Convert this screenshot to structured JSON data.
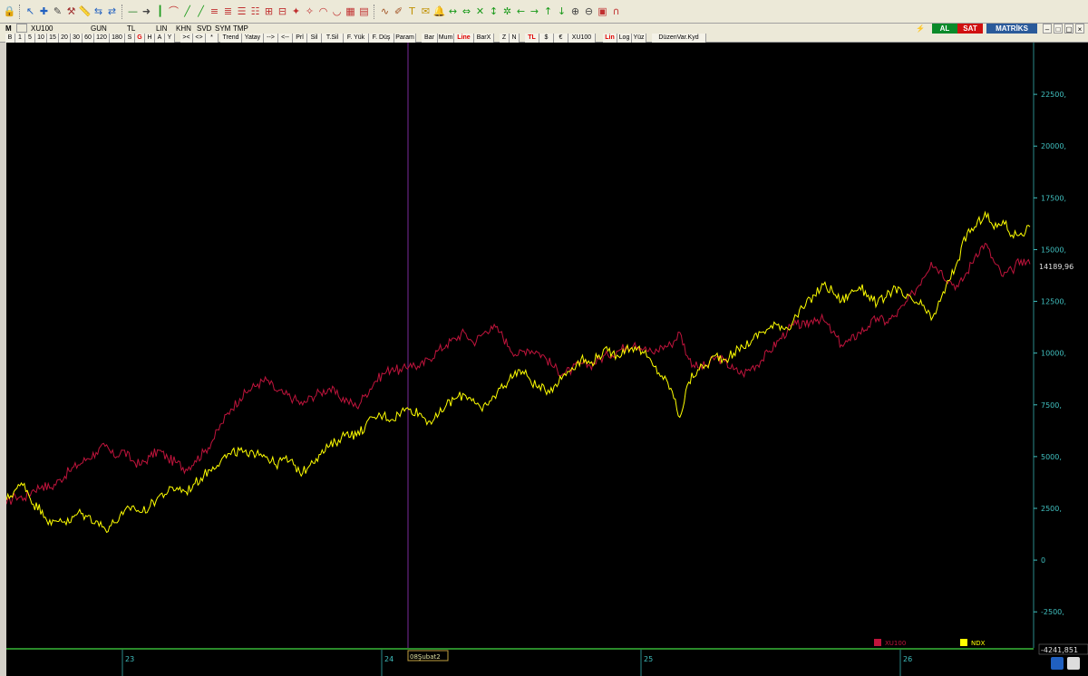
{
  "toolbar": {
    "icons": [
      "lock-icon",
      "cursor-icon",
      "crosshair-icon",
      "pencil-icon",
      "hammer-icon",
      "ruler-icon",
      "align-icon",
      "arrows-icon",
      "minus-icon",
      "vision-icon",
      "line-icon",
      "curve-icon",
      "channel-icon",
      "channel2-icon",
      "fib-icon",
      "fib2-icon",
      "fib3-icon",
      "fib4-icon",
      "gann-icon",
      "gann2-icon",
      "fan-icon",
      "fan2-icon",
      "arc-icon",
      "arc2-icon",
      "grid-icon",
      "grid2-icon",
      "wave-icon",
      "brush-icon",
      "text-icon",
      "note-icon",
      "bell-icon",
      "expand-icon",
      "compress-icon",
      "cross-icon",
      "updown-icon",
      "star-icon",
      "left-icon",
      "right-icon",
      "up-icon",
      "down-icon",
      "zoom-in-icon",
      "zoom-out-icon",
      "image-icon",
      "magnet-icon"
    ]
  },
  "row2": {
    "menu": "M",
    "symbol": "XU100",
    "period": "GUN",
    "currency": "TL",
    "scale": "LIN",
    "khn": "KHN",
    "svd": "SVD",
    "sym": "SYM",
    "tmp": "TMP",
    "al": "AL",
    "sat": "SAT",
    "brand": "MATRİKS"
  },
  "row3": {
    "periods": [
      "B",
      "1",
      "5",
      "10",
      "15",
      "20",
      "30",
      "60",
      "120",
      "180",
      "S",
      "G",
      "H",
      "A",
      "Y"
    ],
    "nav": [
      ">< ",
      "<>",
      "*"
    ],
    "tools": [
      "Trend",
      "Yatay",
      "-->",
      "<--",
      "Prl",
      "Sil",
      "T.Sil",
      "F. Yük",
      "F. Düş",
      "Param"
    ],
    "styles": [
      "Bar",
      "Mum",
      "Line",
      "BarX"
    ],
    "flags": [
      "Z",
      "N"
    ],
    "curr": [
      "TL",
      "$",
      "€",
      "XU100"
    ],
    "axis": [
      "Lin",
      "Log",
      "Yüz"
    ],
    "extra": "DüzenVar.Kyd"
  },
  "chart_data": {
    "type": "line",
    "x_ticks": [
      "23",
      "24",
      "25",
      "26"
    ],
    "y_ticks": [
      22500,
      20000,
      17500,
      15000,
      12500,
      10000,
      7500,
      5000,
      2500,
      0,
      -2500
    ],
    "y_tick_labels": [
      "22500,",
      "20000,",
      "17500,",
      "15000,",
      "12500,",
      "10000,",
      "7500,",
      "5000,",
      "2500,",
      "0",
      "-2500,"
    ],
    "ylim": [
      -4241.85,
      25000
    ],
    "last_value_label": "14189,96",
    "bottom_value_label": "-4241,851",
    "cursor_label": "08Şubat2",
    "series": [
      {
        "name": "XU100",
        "color": "#c0143c",
        "points": [
          [
            0,
            2700
          ],
          [
            2,
            3100
          ],
          [
            4,
            3000
          ],
          [
            6,
            3400
          ],
          [
            8,
            3600
          ],
          [
            10,
            3500
          ],
          [
            12,
            3900
          ],
          [
            14,
            4300
          ],
          [
            16,
            4600
          ],
          [
            18,
            4900
          ],
          [
            20,
            5200
          ],
          [
            22,
            5500
          ],
          [
            24,
            5000
          ],
          [
            26,
            5300
          ],
          [
            28,
            4800
          ],
          [
            30,
            4600
          ],
          [
            32,
            5000
          ],
          [
            34,
            5300
          ],
          [
            36,
            4900
          ],
          [
            38,
            4700
          ],
          [
            40,
            4400
          ],
          [
            42,
            4800
          ],
          [
            44,
            5200
          ],
          [
            46,
            5800
          ],
          [
            48,
            6600
          ],
          [
            50,
            7300
          ],
          [
            52,
            7800
          ],
          [
            54,
            8200
          ],
          [
            56,
            8500
          ],
          [
            58,
            8700
          ],
          [
            60,
            8200
          ],
          [
            62,
            8000
          ],
          [
            64,
            7800
          ],
          [
            66,
            7500
          ],
          [
            68,
            7900
          ],
          [
            70,
            8100
          ],
          [
            72,
            8300
          ],
          [
            74,
            7900
          ],
          [
            76,
            7700
          ],
          [
            78,
            7400
          ],
          [
            80,
            8000
          ],
          [
            82,
            8600
          ],
          [
            84,
            9000
          ],
          [
            86,
            9300
          ],
          [
            88,
            9100
          ],
          [
            90,
            9500
          ],
          [
            92,
            9300
          ],
          [
            94,
            9700
          ],
          [
            96,
            10100
          ],
          [
            98,
            10400
          ],
          [
            100,
            10700
          ],
          [
            102,
            11000
          ],
          [
            104,
            10500
          ],
          [
            106,
            10900
          ],
          [
            108,
            11300
          ],
          [
            110,
            11000
          ],
          [
            112,
            10300
          ],
          [
            114,
            9900
          ],
          [
            116,
            10200
          ],
          [
            118,
            10100
          ],
          [
            120,
            9800
          ],
          [
            122,
            9300
          ],
          [
            124,
            9000
          ],
          [
            126,
            9200
          ],
          [
            128,
            9500
          ],
          [
            130,
            9400
          ],
          [
            132,
            9700
          ],
          [
            134,
            9900
          ],
          [
            136,
            10100
          ],
          [
            138,
            10300
          ],
          [
            140,
            10500
          ],
          [
            142,
            10200
          ],
          [
            144,
            10000
          ],
          [
            146,
            10300
          ],
          [
            148,
            10400
          ],
          [
            150,
            11000
          ],
          [
            152,
            9700
          ],
          [
            154,
            9300
          ],
          [
            156,
            9400
          ],
          [
            158,
            9800
          ],
          [
            160,
            9600
          ],
          [
            162,
            9200
          ],
          [
            164,
            9000
          ],
          [
            166,
            9300
          ],
          [
            168,
            9600
          ],
          [
            170,
            10100
          ],
          [
            172,
            10600
          ],
          [
            174,
            11100
          ],
          [
            176,
            11400
          ],
          [
            178,
            11300
          ],
          [
            180,
            11700
          ],
          [
            182,
            11600
          ],
          [
            184,
            11000
          ],
          [
            186,
            10400
          ],
          [
            188,
            10600
          ],
          [
            190,
            11000
          ],
          [
            192,
            11300
          ],
          [
            194,
            11700
          ],
          [
            196,
            11500
          ],
          [
            198,
            11800
          ],
          [
            200,
            12300
          ],
          [
            202,
            12900
          ],
          [
            204,
            13600
          ],
          [
            206,
            14400
          ],
          [
            208,
            14000
          ],
          [
            210,
            13500
          ],
          [
            212,
            13200
          ],
          [
            214,
            13900
          ],
          [
            216,
            14800
          ],
          [
            218,
            15300
          ],
          [
            220,
            14400
          ],
          [
            222,
            13700
          ],
          [
            224,
            14000
          ],
          [
            226,
            14500
          ],
          [
            228,
            14300
          ]
        ]
      },
      {
        "name": "NDX",
        "color": "#ffff00",
        "points": [
          [
            0,
            2900
          ],
          [
            2,
            3400
          ],
          [
            4,
            3700
          ],
          [
            6,
            2700
          ],
          [
            8,
            2400
          ],
          [
            10,
            1700
          ],
          [
            12,
            2000
          ],
          [
            14,
            1800
          ],
          [
            16,
            2300
          ],
          [
            18,
            2100
          ],
          [
            20,
            1900
          ],
          [
            22,
            1500
          ],
          [
            24,
            1800
          ],
          [
            26,
            2200
          ],
          [
            28,
            2600
          ],
          [
            30,
            2300
          ],
          [
            32,
            2600
          ],
          [
            34,
            3100
          ],
          [
            36,
            3300
          ],
          [
            38,
            3500
          ],
          [
            40,
            3300
          ],
          [
            42,
            3700
          ],
          [
            44,
            4100
          ],
          [
            46,
            4500
          ],
          [
            48,
            4900
          ],
          [
            50,
            5100
          ],
          [
            52,
            5300
          ],
          [
            54,
            5000
          ],
          [
            56,
            5300
          ],
          [
            58,
            5000
          ],
          [
            60,
            4600
          ],
          [
            62,
            4900
          ],
          [
            64,
            4600
          ],
          [
            66,
            4200
          ],
          [
            68,
            4800
          ],
          [
            70,
            5100
          ],
          [
            72,
            5500
          ],
          [
            74,
            5800
          ],
          [
            76,
            6200
          ],
          [
            78,
            6000
          ],
          [
            80,
            6500
          ],
          [
            82,
            6900
          ],
          [
            84,
            7000
          ],
          [
            86,
            6800
          ],
          [
            88,
            7200
          ],
          [
            90,
            7300
          ],
          [
            92,
            7100
          ],
          [
            94,
            6700
          ],
          [
            96,
            6900
          ],
          [
            98,
            7500
          ],
          [
            100,
            7800
          ],
          [
            102,
            8000
          ],
          [
            104,
            7800
          ],
          [
            106,
            7200
          ],
          [
            108,
            7700
          ],
          [
            110,
            8300
          ],
          [
            112,
            8700
          ],
          [
            114,
            9200
          ],
          [
            116,
            8900
          ],
          [
            118,
            8400
          ],
          [
            120,
            8200
          ],
          [
            122,
            8400
          ],
          [
            124,
            8900
          ],
          [
            126,
            9300
          ],
          [
            128,
            9700
          ],
          [
            130,
            9500
          ],
          [
            132,
            9900
          ],
          [
            134,
            10100
          ],
          [
            136,
            9900
          ],
          [
            138,
            10200
          ],
          [
            140,
            10300
          ],
          [
            142,
            10000
          ],
          [
            144,
            9400
          ],
          [
            146,
            8900
          ],
          [
            148,
            8300
          ],
          [
            150,
            6900
          ],
          [
            152,
            8600
          ],
          [
            154,
            9200
          ],
          [
            156,
            9400
          ],
          [
            158,
            9900
          ],
          [
            160,
            9700
          ],
          [
            162,
            10000
          ],
          [
            164,
            10300
          ],
          [
            166,
            10600
          ],
          [
            168,
            11000
          ],
          [
            170,
            11200
          ],
          [
            172,
            11400
          ],
          [
            174,
            11200
          ],
          [
            176,
            11800
          ],
          [
            178,
            12300
          ],
          [
            180,
            12800
          ],
          [
            182,
            13300
          ],
          [
            184,
            13000
          ],
          [
            186,
            12500
          ],
          [
            188,
            12900
          ],
          [
            190,
            13200
          ],
          [
            192,
            12800
          ],
          [
            194,
            12400
          ],
          [
            196,
            12700
          ],
          [
            198,
            13200
          ],
          [
            200,
            12700
          ],
          [
            202,
            12500
          ],
          [
            204,
            12300
          ],
          [
            206,
            11600
          ],
          [
            208,
            12500
          ],
          [
            210,
            13500
          ],
          [
            212,
            14500
          ],
          [
            214,
            15800
          ],
          [
            216,
            16100
          ],
          [
            218,
            16800
          ],
          [
            220,
            16000
          ],
          [
            222,
            16400
          ],
          [
            224,
            15700
          ],
          [
            226,
            15800
          ],
          [
            228,
            16100
          ]
        ]
      }
    ],
    "x_range": [
      0,
      228
    ]
  }
}
